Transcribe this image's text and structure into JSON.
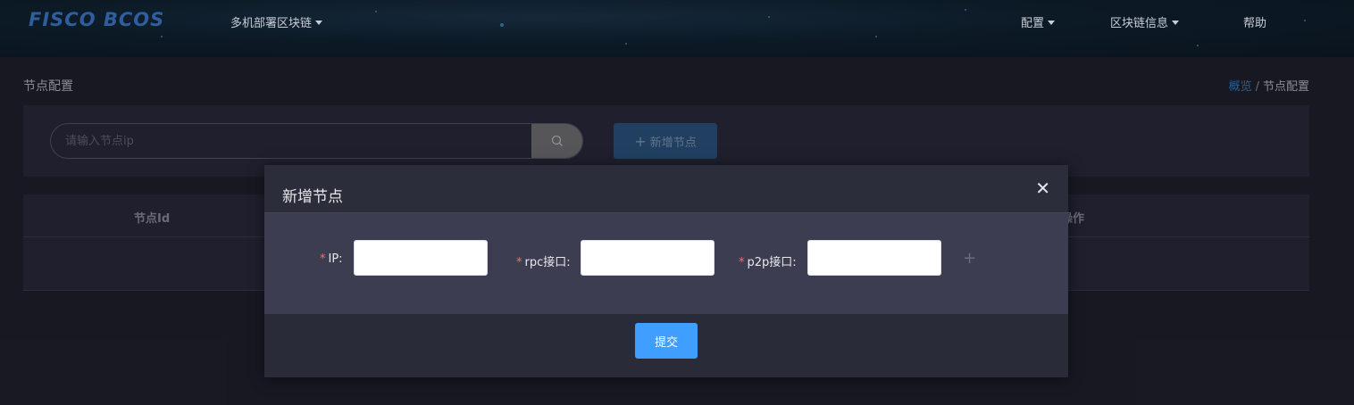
{
  "header": {
    "logo": "FISCO BCOS",
    "nav": [
      {
        "label": "多机部署区块链",
        "has_dropdown": true
      },
      {
        "label": "配置",
        "has_dropdown": true
      },
      {
        "label": "区块链信息",
        "has_dropdown": true
      },
      {
        "label": "帮助",
        "has_dropdown": false
      }
    ]
  },
  "page": {
    "title": "节点配置",
    "breadcrumb": {
      "link": "概览",
      "separator": "/",
      "current": "节点配置"
    }
  },
  "search": {
    "placeholder": "请输入节点ip",
    "button_icon": "search-icon"
  },
  "toolbar": {
    "add_node_plus": "+",
    "add_node_label": "新增节点"
  },
  "table": {
    "columns": [
      "节点Id",
      "操作"
    ],
    "rows": []
  },
  "modal": {
    "title": "新增节点",
    "close_icon": "close-icon",
    "fields": [
      {
        "required_mark": "*",
        "label": "IP:",
        "value": ""
      },
      {
        "required_mark": "*",
        "label": "rpc接口:",
        "value": ""
      },
      {
        "required_mark": "*",
        "label": "p2p接口:",
        "value": ""
      }
    ],
    "add_row_icon": "+",
    "submit_label": "提交"
  },
  "colors": {
    "accent": "#409eff",
    "link": "#3d8bd1",
    "required": "#f56c6c",
    "background": "#20212b",
    "panel": "#2b2c3c"
  }
}
